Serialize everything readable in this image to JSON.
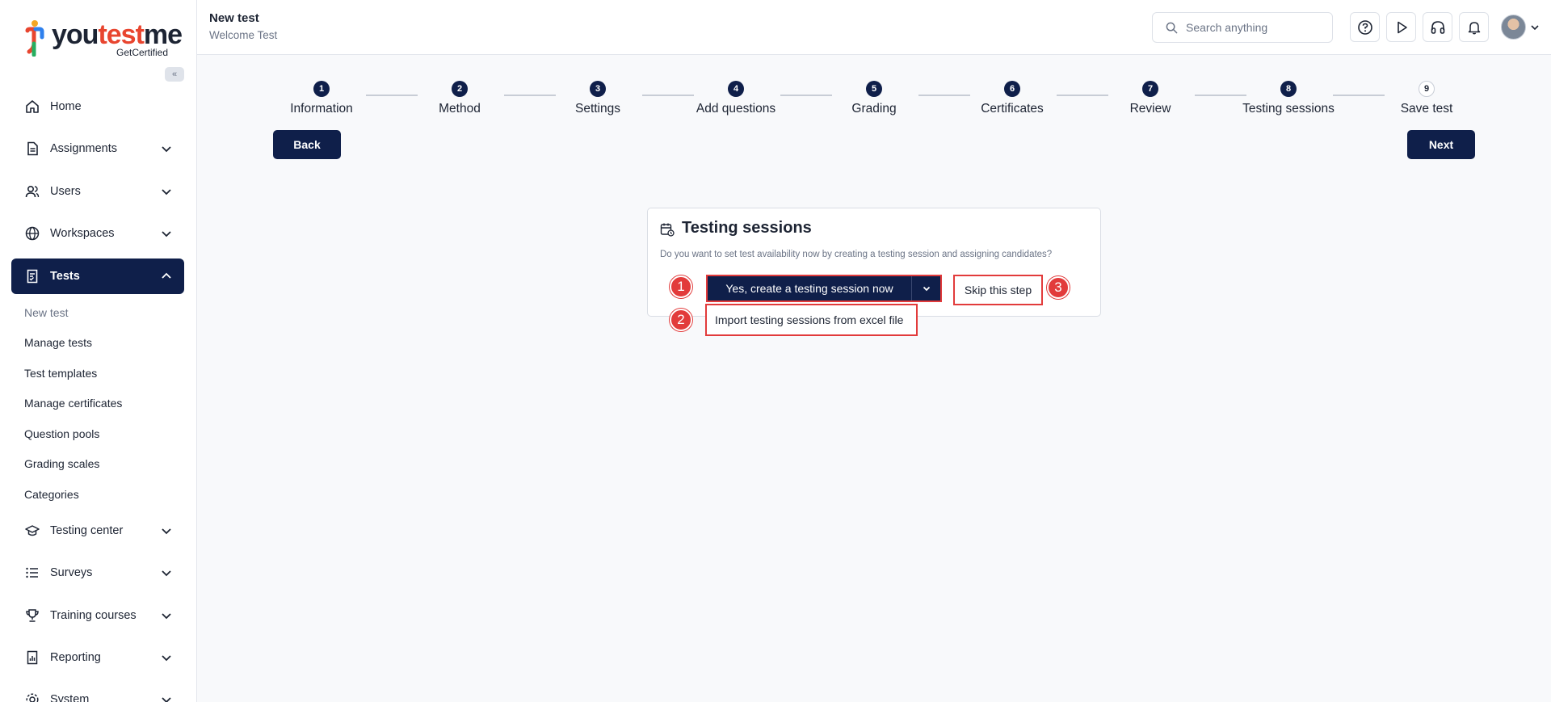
{
  "brand": {
    "word_start": "you",
    "word_accent": "test",
    "word_end": "me",
    "tagline": "GetCertified"
  },
  "sidebar": {
    "collapse_label": "«",
    "items": [
      {
        "label": "Home",
        "icon": "home-icon"
      },
      {
        "label": "Assignments",
        "icon": "document-icon"
      },
      {
        "label": "Users",
        "icon": "users-icon"
      },
      {
        "label": "Workspaces",
        "icon": "globe-icon"
      },
      {
        "label": "Tests",
        "icon": "test-icon"
      },
      {
        "label": "Testing center",
        "icon": "graduation-cap-icon"
      },
      {
        "label": "Surveys",
        "icon": "list-icon"
      },
      {
        "label": "Training courses",
        "icon": "trophy-icon"
      },
      {
        "label": "Reporting",
        "icon": "report-icon"
      },
      {
        "label": "System",
        "icon": "gear-icon"
      }
    ],
    "tests_sub": [
      "New test",
      "Manage tests",
      "Test templates",
      "Manage certificates",
      "Question pools",
      "Grading scales",
      "Categories"
    ]
  },
  "header": {
    "title": "New test",
    "subtitle": "Welcome Test",
    "search_placeholder": "Search anything"
  },
  "stepper": {
    "steps": [
      {
        "num": "1",
        "label": "Information"
      },
      {
        "num": "2",
        "label": "Method"
      },
      {
        "num": "3",
        "label": "Settings"
      },
      {
        "num": "4",
        "label": "Add questions"
      },
      {
        "num": "5",
        "label": "Grading"
      },
      {
        "num": "6",
        "label": "Certificates"
      },
      {
        "num": "7",
        "label": "Review"
      },
      {
        "num": "8",
        "label": "Testing sessions"
      },
      {
        "num": "9",
        "label": "Save test"
      }
    ],
    "back_label": "Back",
    "next_label": "Next"
  },
  "card": {
    "title": "Testing sessions",
    "description": "Do you want to set test availability now by creating a testing session and assigning candidates?",
    "primary_label": "Yes, create a testing session now",
    "skip_label": "Skip this step",
    "dropdown_item": "Import testing sessions from excel file"
  },
  "markers": [
    "1",
    "2",
    "3"
  ],
  "colors": {
    "navy": "#0f1f4a",
    "highlight": "#e23b3b",
    "brand_accent": "#e8452f"
  }
}
